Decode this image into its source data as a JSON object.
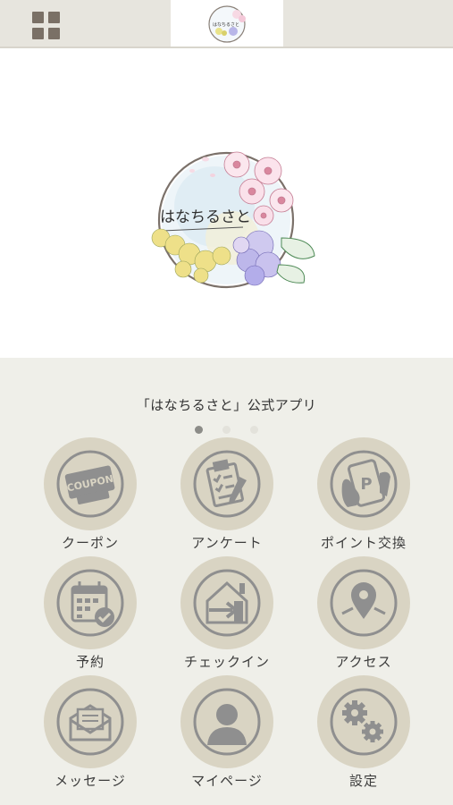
{
  "header": {
    "menu_icon": "grid-menu-icon"
  },
  "hero": {
    "logo_text": "はなちるさと"
  },
  "app_title": "「はなちるさと」公式アプリ",
  "pager": {
    "count": 3,
    "active": 1
  },
  "menu": [
    {
      "label": "クーポン",
      "icon": "coupon-icon",
      "icon_text": "COUPON"
    },
    {
      "label": "アンケート",
      "icon": "survey-icon"
    },
    {
      "label": "ポイント交換",
      "icon": "point-exchange-icon",
      "icon_text": "P"
    },
    {
      "label": "予約",
      "icon": "calendar-icon"
    },
    {
      "label": "チェックイン",
      "icon": "checkin-icon"
    },
    {
      "label": "アクセス",
      "icon": "map-pin-icon"
    },
    {
      "label": "メッセージ",
      "icon": "message-icon"
    },
    {
      "label": "マイページ",
      "icon": "user-icon"
    },
    {
      "label": "設定",
      "icon": "gear-icon"
    }
  ],
  "colors": {
    "tile_bg": "#d9d4c3",
    "icon": "#8f8f8f",
    "page_bg": "#efefe9",
    "header_bg": "#e7e5de"
  }
}
